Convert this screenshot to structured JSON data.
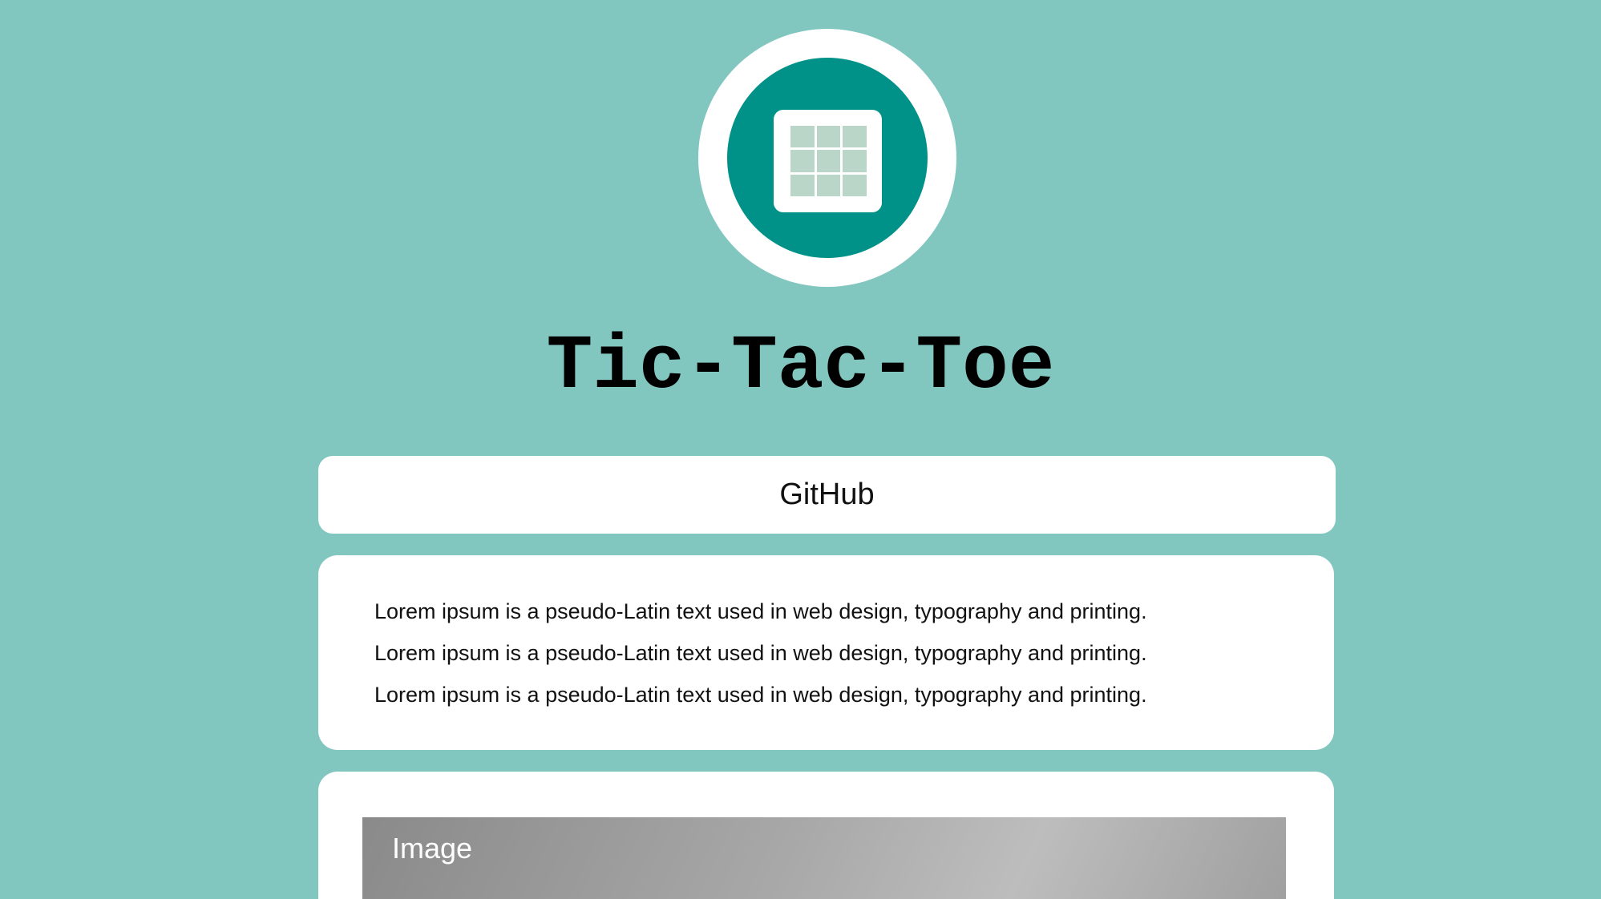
{
  "app": {
    "title": "Tic-Tac-Toe"
  },
  "logo": {
    "icon": "grid-icon"
  },
  "links": {
    "github_label": "GitHub"
  },
  "description": {
    "lines": [
      "Lorem ipsum is a pseudo-Latin text used in web design, typography and printing.",
      "Lorem ipsum is a pseudo-Latin text used in web design, typography and printing.",
      "Lorem ipsum is a pseudo-Latin text used in web design, typography and printing."
    ]
  },
  "image": {
    "label": "Image"
  },
  "colors": {
    "background": "#82c6c0",
    "accent": "#009188",
    "grid_cell": "#b9d6c9",
    "card": "#ffffff"
  }
}
